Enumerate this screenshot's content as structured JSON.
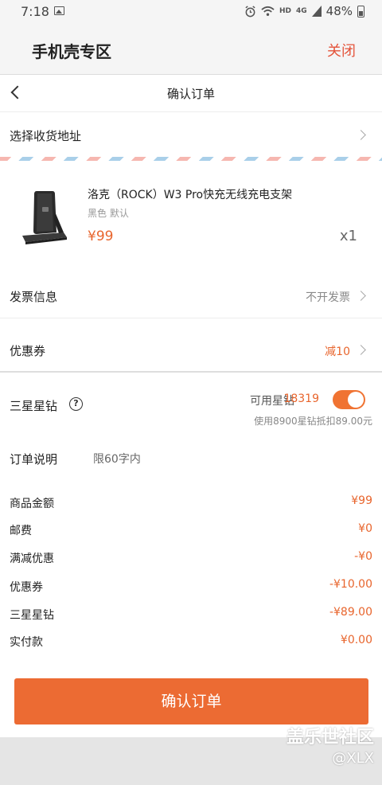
{
  "status_bar": {
    "time": "7:18",
    "network": "HD",
    "signal": "4G",
    "battery": "48%"
  },
  "header": {
    "title": "手机壳专区",
    "close_label": "关闭"
  },
  "nav": {
    "title": "确认订单"
  },
  "address": {
    "label": "选择收货地址"
  },
  "product": {
    "name": "洛克（ROCK）W3 Pro快充无线充电支架",
    "spec": "黑色 默认",
    "price": "¥99",
    "qty": "x1"
  },
  "invoice": {
    "label": "发票信息",
    "value": "不开发票"
  },
  "coupon": {
    "label": "优惠券",
    "value": "减10"
  },
  "stars": {
    "label": "三星星钻",
    "available_label": "可用星钻",
    "available_value": "18319",
    "note": "使用8900星钻抵扣89.00元",
    "toggle_on": true
  },
  "order_note": {
    "label": "订单说明",
    "placeholder": "限60字内"
  },
  "summary": [
    {
      "label": "商品金额",
      "value": "¥99"
    },
    {
      "label": "邮费",
      "value": "¥0"
    },
    {
      "label": "满减优惠",
      "value": "-¥0"
    },
    {
      "label": "优惠券",
      "value": "-¥10.00"
    },
    {
      "label": "三星星钻",
      "value": "-¥89.00"
    },
    {
      "label": "实付款",
      "value": "¥0.00"
    }
  ],
  "submit": {
    "label": "确认订单"
  },
  "watermark": {
    "line1": "盖乐世社区",
    "line2": "@XLX"
  },
  "colors": {
    "accent": "#ec6b33",
    "close": "#e4533a"
  }
}
